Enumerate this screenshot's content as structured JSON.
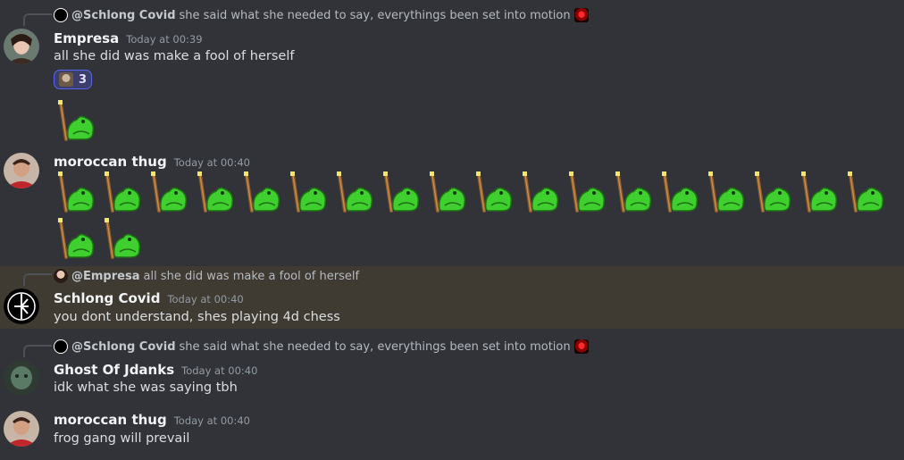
{
  "messages": [
    {
      "reply": {
        "name": "@Schlong Covid",
        "text": "she said what she needed to say, everythings been set into motion"
      },
      "author": "Empresa",
      "time": "Today at 00:39",
      "text": "all she did was make a fool of herself",
      "reaction_count": "3",
      "emoji_count": 1
    },
    {
      "author": "moroccan thug",
      "time": "Today at 00:40",
      "emoji_count": 20,
      "emoji_name": "frog-with-spear-emoji"
    },
    {
      "reply": {
        "name": "@Empresa",
        "text": "all she did was make a fool of herself"
      },
      "author": "Schlong Covid",
      "time": "Today at 00:40",
      "text": "you dont understand, shes playing 4d chess",
      "highlighted": true
    },
    {
      "reply": {
        "name": "@Schlong Covid",
        "text": "she said what she needed to say, everythings been set into motion"
      },
      "author": "Ghost Of Jdanks",
      "time": "Today at 00:40",
      "text": "idk what she was saying tbh"
    },
    {
      "author": "moroccan thug",
      "time": "Today at 00:40",
      "text": "frog gang will prevail"
    }
  ],
  "colors": {
    "background": "#313338",
    "highlight": "#3f3b33",
    "reaction_border": "#5865f2",
    "frog_green": "#3fcf2f"
  }
}
